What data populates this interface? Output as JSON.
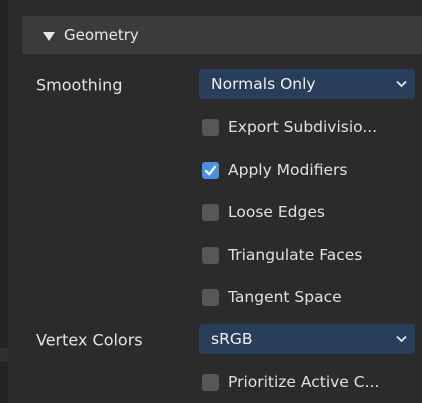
{
  "panel": {
    "title": "Geometry",
    "expand_icon": "triangle-down-icon"
  },
  "smoothing": {
    "label": "Smoothing",
    "value": "Normals Only",
    "accent": "#283e5b"
  },
  "checkboxes": [
    {
      "label": "Export Subdivisio...",
      "checked": false
    },
    {
      "label": "Apply Modifiers",
      "checked": true
    },
    {
      "label": "Loose Edges",
      "checked": false
    },
    {
      "label": "Triangulate Faces",
      "checked": false
    },
    {
      "label": "Tangent Space",
      "checked": false
    }
  ],
  "vertex_colors": {
    "label": "Vertex Colors",
    "value": "sRGB"
  },
  "checkboxes_bottom": [
    {
      "label": "Prioritize Active C...",
      "checked": false
    }
  ],
  "colors": {
    "background": "#2b2b2b",
    "header": "#3b3b3b",
    "checkbox_on": "#4a90e2",
    "checkbox_off": "#575757"
  }
}
